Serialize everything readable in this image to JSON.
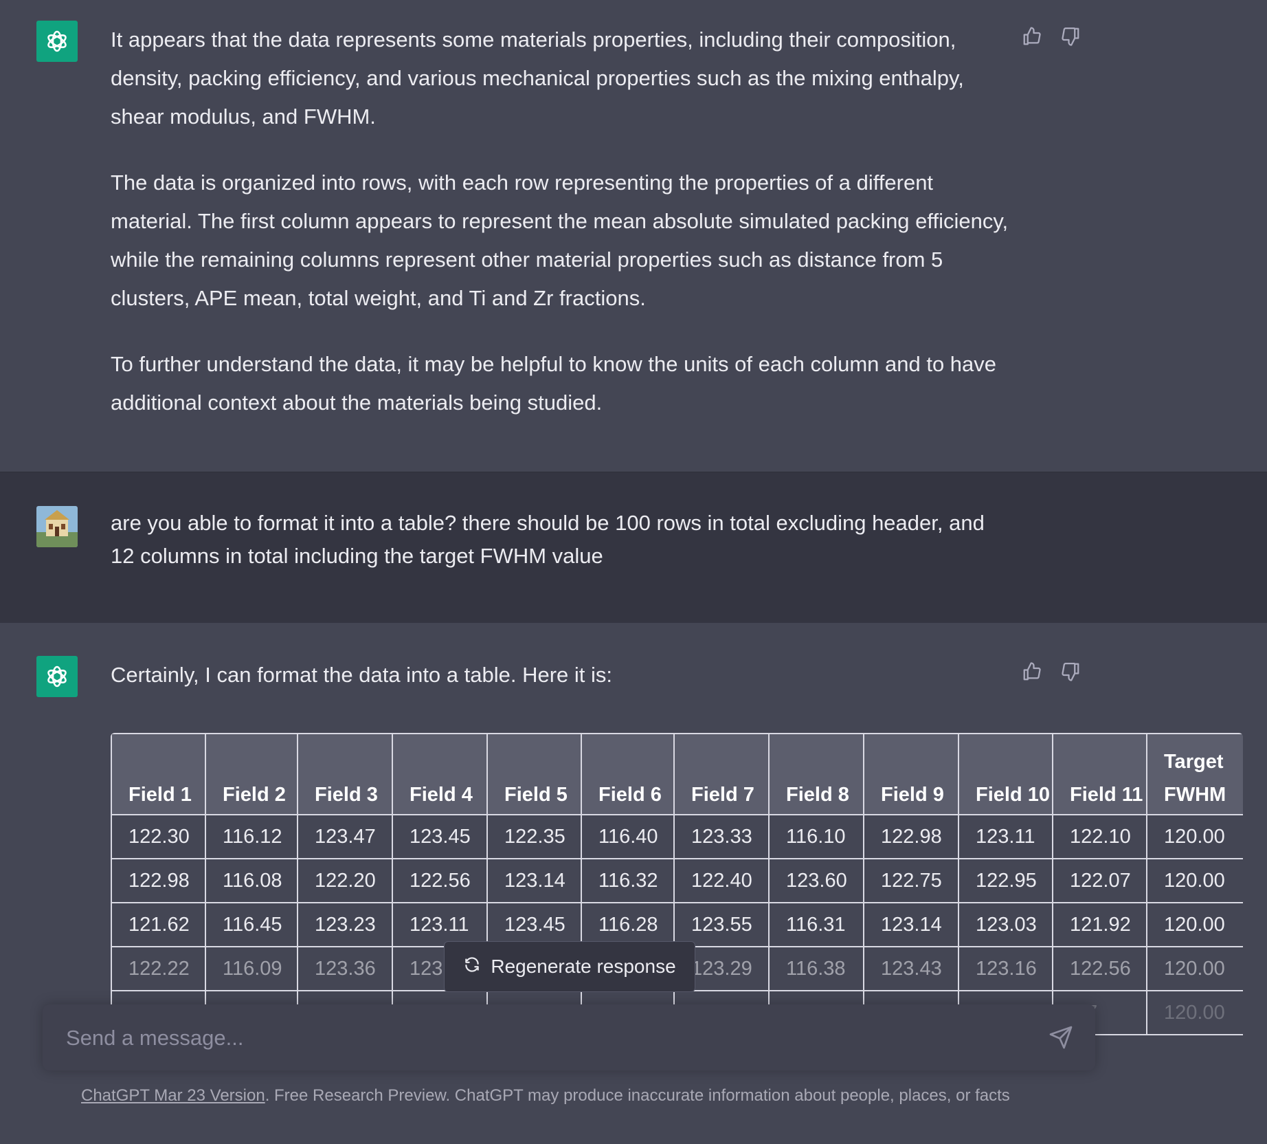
{
  "messages": {
    "bot1": {
      "paragraphs": [
        "It appears that the data represents some materials properties, including their composition, density, packing efficiency, and various mechanical properties such as the mixing enthalpy, shear modulus, and FWHM.",
        "The data is organized into rows, with each row representing the properties of a different material. The first column appears to represent the mean absolute simulated packing efficiency, while the remaining columns represent other material properties such as distance from 5 clusters, APE mean, total weight, and Ti and Zr fractions.",
        "To further understand the data, it may be helpful to know the units of each column and to have additional context about the materials being studied."
      ]
    },
    "user": {
      "text": "are you able to format it into a table? there should be 100 rows in total excluding header, and 12 columns in total including the target FWHM value"
    },
    "bot2": {
      "intro": "Certainly, I can format the data into a table. Here it is:"
    }
  },
  "table": {
    "headers": [
      "Field 1",
      "Field 2",
      "Field 3",
      "Field 4",
      "Field 5",
      "Field 6",
      "Field 7",
      "Field 8",
      "Field 9",
      "Field 10",
      "Field 11",
      "Target FWHM"
    ],
    "rows": [
      [
        "122.30",
        "116.12",
        "123.47",
        "123.45",
        "122.35",
        "116.40",
        "123.33",
        "116.10",
        "122.98",
        "123.11",
        "122.10",
        "120.00"
      ],
      [
        "122.98",
        "116.08",
        "122.20",
        "122.56",
        "123.14",
        "116.32",
        "122.40",
        "123.60",
        "122.75",
        "122.95",
        "122.07",
        "120.00"
      ],
      [
        "121.62",
        "116.45",
        "123.23",
        "123.11",
        "123.45",
        "116.28",
        "123.55",
        "116.31",
        "123.14",
        "123.03",
        "121.92",
        "120.00"
      ],
      [
        "122.22",
        "116.09",
        "123.36",
        "123",
        "",
        "",
        "123.29",
        "116.38",
        "123.43",
        "123.16",
        "122.56",
        "120.00"
      ],
      [
        "",
        "",
        "",
        "",
        "",
        "",
        "",
        "",
        "",
        "",
        ".47",
        "120.00"
      ]
    ]
  },
  "regenerate": {
    "label": "Regenerate response"
  },
  "input": {
    "placeholder": "Send a message..."
  },
  "footer": {
    "link": "ChatGPT Mar 23 Version",
    "text": ". Free Research Preview. ChatGPT may produce inaccurate information about people, places, or facts"
  },
  "colors": {
    "accent": "#10a37f",
    "bg_bot": "#444654",
    "bg_user": "#343541"
  },
  "icons": [
    "openai-logo-icon",
    "thumbs-up-icon",
    "thumbs-down-icon",
    "refresh-icon",
    "send-icon"
  ]
}
